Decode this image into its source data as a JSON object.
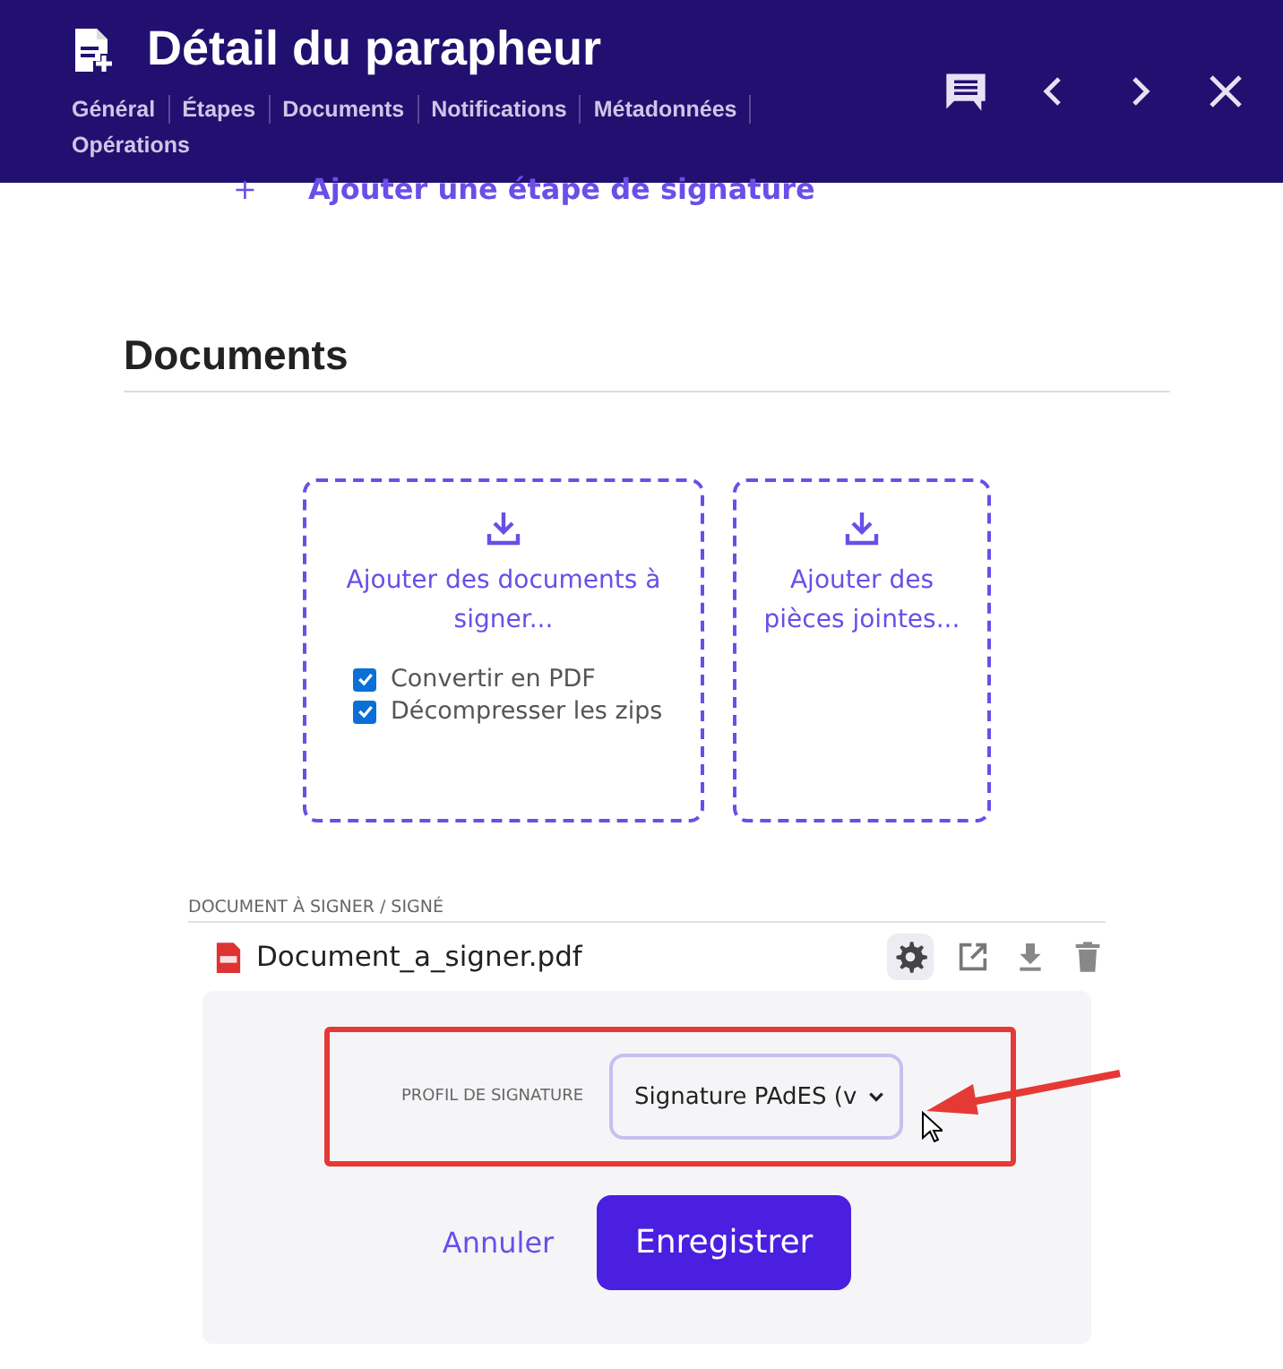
{
  "header": {
    "title": "Détail du parapheur",
    "tabs": [
      {
        "label": "Général"
      },
      {
        "label": "Étapes"
      },
      {
        "label": "Documents"
      },
      {
        "label": "Notifications"
      },
      {
        "label": "Métadonnées"
      },
      {
        "label": "Opérations"
      }
    ]
  },
  "add_step": {
    "icon": "+",
    "label": "Ajouter une étape de signature"
  },
  "section": {
    "title": "Documents"
  },
  "dropzones": [
    {
      "label": "Ajouter des documents à signer...",
      "options": [
        {
          "label": "Convertir en PDF",
          "checked": true
        },
        {
          "label": "Décompresser les zips",
          "checked": true
        }
      ]
    },
    {
      "label": "Ajouter des pièces jointes..."
    }
  ],
  "document_list": {
    "heading": "DOCUMENT À SIGNER / SIGNÉ",
    "files": [
      {
        "name": "Document_a_signer.pdf"
      }
    ]
  },
  "settings_panel": {
    "field_label": "PROFIL DE SIGNATURE",
    "select_value": "Signature PAdES (v",
    "cancel": "Annuler",
    "save": "Enregistrer"
  }
}
